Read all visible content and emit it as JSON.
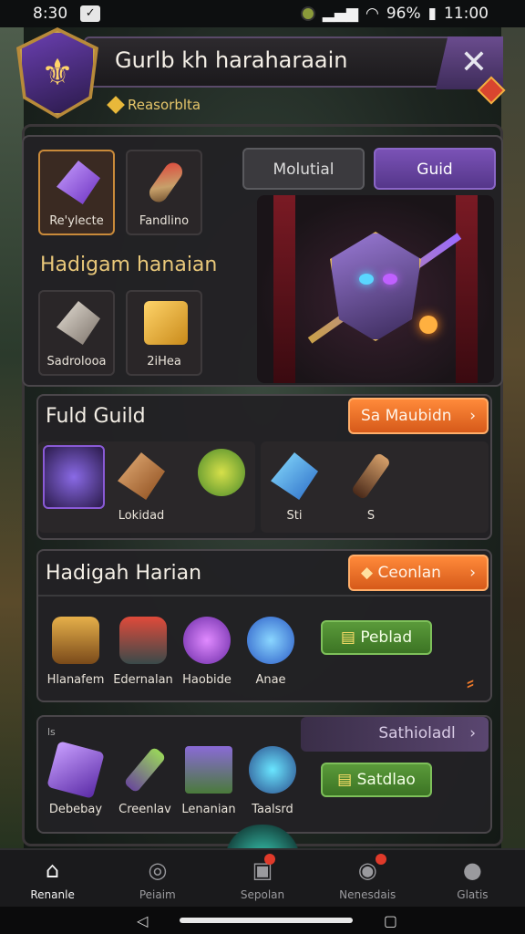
{
  "status": {
    "time": "8:30",
    "battery": "96%",
    "clock": "11:00"
  },
  "header": {
    "title": "Gurlb kh haraharaain",
    "sub_label": "Reasorblta"
  },
  "top_panel": {
    "slots": [
      {
        "label": "Re'ylecte"
      },
      {
        "label": "Fandlino"
      }
    ],
    "tabs": [
      {
        "label": "Molutial"
      },
      {
        "label": "Guid"
      }
    ],
    "section_title": "Hadigam hanaian",
    "slots2": [
      {
        "label": "Sadrolooa"
      },
      {
        "label": "2iHea"
      }
    ]
  },
  "guild_panel": {
    "title": "Fuld Guild",
    "action": "Sa Maubidn",
    "items": [
      {
        "label": ""
      },
      {
        "label": "Lokidad"
      },
      {
        "label": ""
      },
      {
        "label": "Sti"
      },
      {
        "label": "S"
      }
    ]
  },
  "harian_panel": {
    "title": "Hadigah Harian",
    "action": "Ceonlan",
    "items": [
      {
        "label": "Hlanafem"
      },
      {
        "label": "Edernalan"
      },
      {
        "label": "Haobide"
      },
      {
        "label": "Anae"
      }
    ],
    "green_button": "Peblad"
  },
  "bottom_panel": {
    "corner_label": "ls",
    "bar_label": "Sathioladl",
    "items": [
      {
        "label": "Debebay"
      },
      {
        "label": "Creenlav"
      },
      {
        "label": "Lenanian"
      },
      {
        "label": "Taalsrd"
      }
    ],
    "green_button": "Satdlao"
  },
  "nav": [
    {
      "label": "Renanle"
    },
    {
      "label": "Peiaim"
    },
    {
      "label": "Sepolan"
    },
    {
      "label": "Nenesdais"
    },
    {
      "label": "Glatis"
    }
  ],
  "colors": {
    "accent_purple": "#6a4c8e",
    "accent_orange": "#f07a2a",
    "accent_green": "#4e8a30"
  }
}
